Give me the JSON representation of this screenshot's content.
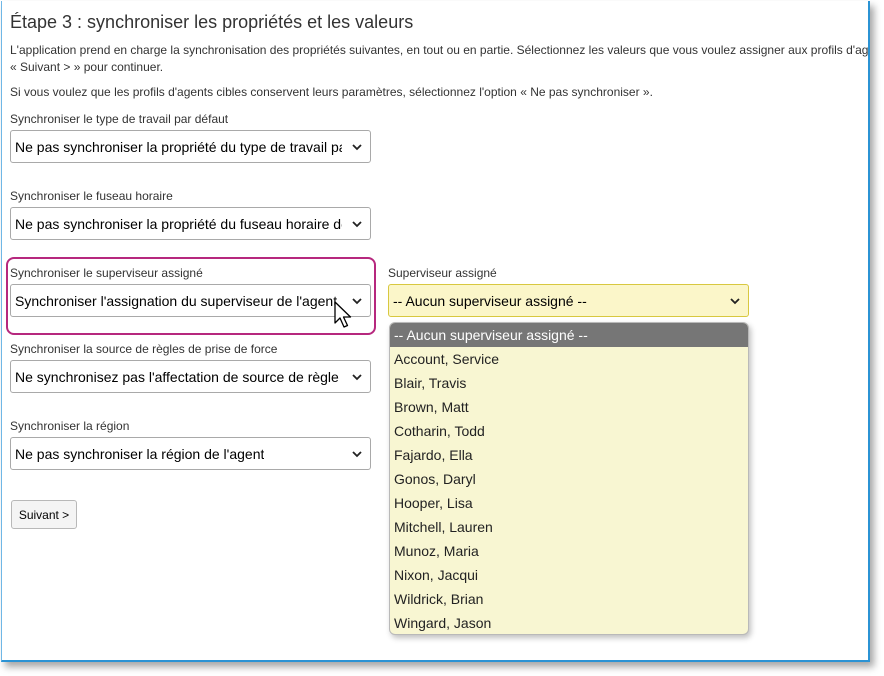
{
  "page": {
    "title": "Étape 3 : synchroniser les propriétés et les valeurs",
    "intro_line1": "L'application prend en charge la synchronisation des propriétés suivantes, en tout ou en partie. Sélectionnez les valeurs que vous voulez assigner aux profils d'agents",
    "intro_line2": "« Suivant > » pour continuer.",
    "note": "Si vous voulez que les profils d'agents cibles conservent leurs paramètres, sélectionnez l'option « Ne pas synchroniser »."
  },
  "fields": {
    "worktype": {
      "label": "Synchroniser le type de travail par défaut",
      "value": "Ne pas synchroniser la propriété du type de travail par défaut"
    },
    "timezone": {
      "label": "Synchroniser le fuseau horaire",
      "value": "Ne pas synchroniser la propriété du fuseau horaire de l'agent"
    },
    "supervisor": {
      "label": "Synchroniser le superviseur assigné",
      "value": "Synchroniser l'assignation du superviseur de l'agent"
    },
    "forcerule": {
      "label": "Synchroniser la source de règles de prise de force",
      "value": "Ne synchronisez pas l'affectation de source de règle de prise de force"
    },
    "region": {
      "label": "Synchroniser la région",
      "value": "Ne pas synchroniser la région de l'agent"
    }
  },
  "assigned_supervisor": {
    "label": "Superviseur assigné",
    "value": "-- Aucun superviseur assigné --",
    "options": [
      "-- Aucun superviseur assigné --",
      "Account, Service",
      "Blair, Travis",
      "Brown, Matt",
      "Cotharin, Todd",
      "Fajardo, Ella",
      "Gonos, Daryl",
      "Hooper, Lisa",
      "Mitchell, Lauren",
      "Munoz, Maria",
      "Nixon, Jacqui",
      "Wildrick, Brian",
      "Wingard, Jason"
    ]
  },
  "buttons": {
    "next": "Suivant >"
  },
  "colors": {
    "highlight": "#b6287e",
    "frame": "#2b93d4",
    "dropdown_bg": "#f8f6d2",
    "dropdown_selected": "#767676"
  }
}
